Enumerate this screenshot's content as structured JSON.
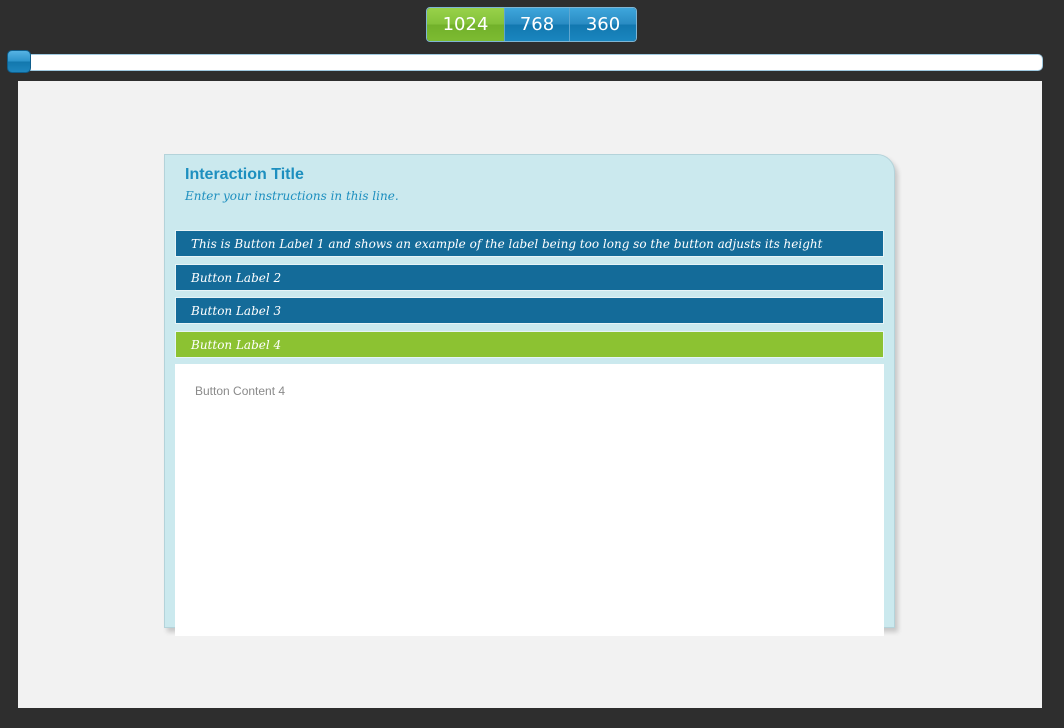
{
  "size_toggle": {
    "options": [
      "1024",
      "768",
      "360"
    ],
    "selected": "1024"
  },
  "slider": {
    "value": 0
  },
  "interaction": {
    "title": "Interaction Title",
    "instructions": "Enter your instructions in this line.",
    "buttons": [
      {
        "label": "This is Button Label 1 and shows an example of the label being too long so the button adjusts its height",
        "active": false
      },
      {
        "label": "Button Label 2",
        "active": false
      },
      {
        "label": "Button Label 3",
        "active": false
      },
      {
        "label": "Button Label 4",
        "active": true
      }
    ],
    "content": "Button Content 4"
  },
  "colors": {
    "background": "#2e2e2e",
    "stage": "#f2f2f2",
    "card": "#cbe9ee",
    "title": "#1d8fbf",
    "button_default": "#146b99",
    "button_active": "#8cc232",
    "toggle_blue": "#2a8cc3",
    "toggle_green": "#84c23a"
  }
}
